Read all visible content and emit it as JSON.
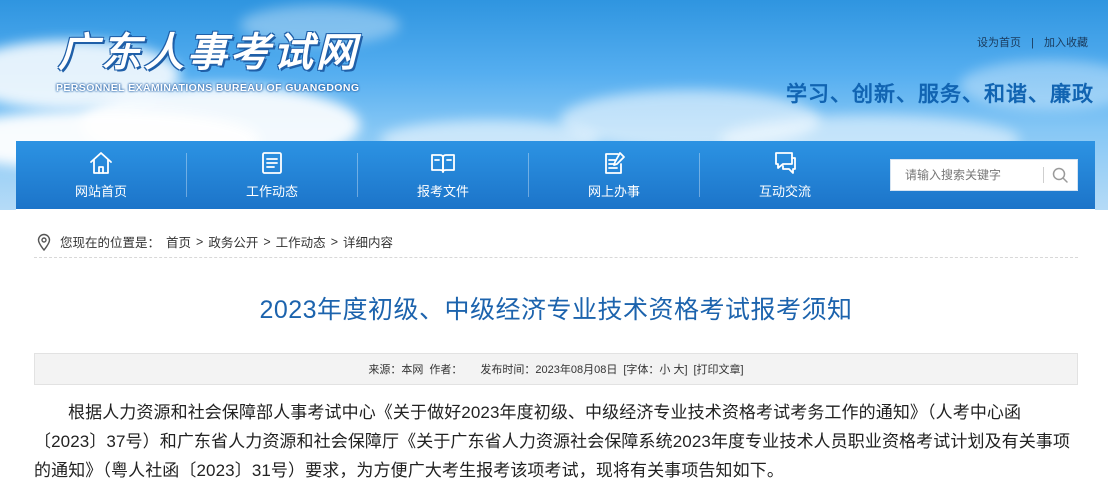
{
  "header": {
    "logo_cn": "广东人事考试网",
    "logo_en": "PERSONNEL EXAMINATIONS BUREAU OF GUANGDONG",
    "top_links": [
      "设为首页",
      "加入收藏"
    ],
    "top_link_separator": "|",
    "slogan": "学习、创新、服务、和谐、廉政"
  },
  "nav": {
    "items": [
      {
        "label": "网站首页",
        "icon": "home-icon"
      },
      {
        "label": "工作动态",
        "icon": "news-list-icon"
      },
      {
        "label": "报考文件",
        "icon": "open-book-icon"
      },
      {
        "label": "网上办事",
        "icon": "clipboard-pen-icon"
      },
      {
        "label": "互动交流",
        "icon": "chat-bubbles-icon"
      }
    ],
    "search": {
      "placeholder": "请输入搜索关键字",
      "icon": "search-icon"
    }
  },
  "breadcrumb": {
    "prefix": "您现在的位置是：",
    "items": [
      "首页",
      "政务公开",
      "工作动态",
      "详细内容"
    ],
    "separator": ">"
  },
  "article": {
    "title": "2023年度初级、中级经济专业技术资格考试报考须知",
    "meta": {
      "source": "来源：本网",
      "author": "作者：",
      "date": "发布时间：2023年08月08日",
      "font_size": "[字体：小 大]",
      "print": "[打印文章]"
    },
    "body": "根据人力资源和社会保障部人事考试中心《关于做好2023年度初级、中级经济专业技术资格考试考务工作的通知》（人考中心函〔2023〕37号）和广东省人力资源和社会保障厅《关于广东省人力资源社会保障系统2023年度专业技术人员职业资格考试计划及有关事项的通知》（粤人社函〔2023〕31号）要求，为方便广大考生报考该项考试，现将有关事项告知如下。"
  },
  "colors": {
    "nav_bg": "#1f7ccf",
    "title": "#1c63ad",
    "slogan": "#1164b2"
  }
}
